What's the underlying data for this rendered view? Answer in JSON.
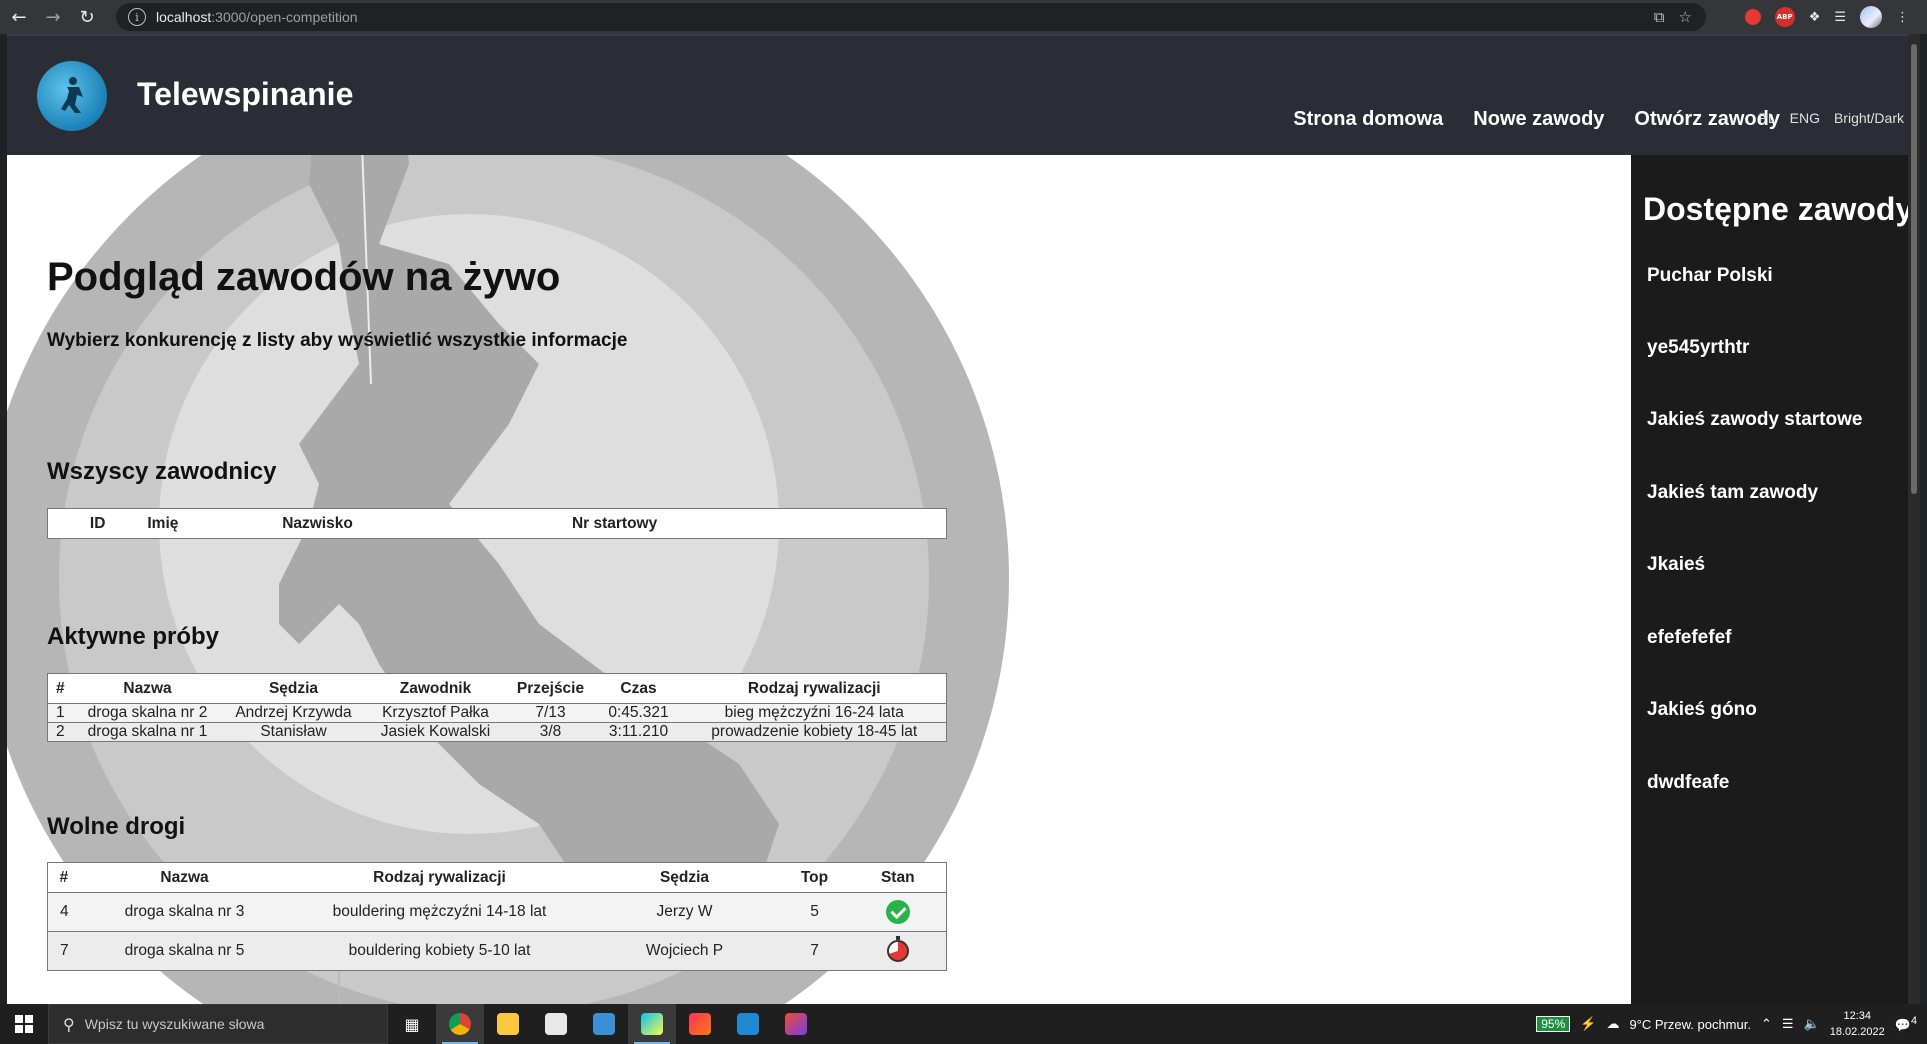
{
  "browser": {
    "url_host": "localhost",
    "url_path": ":3000/open-competition"
  },
  "app": {
    "brand": "Telewspinanie",
    "nav": [
      "Strona domowa",
      "Nowe zawody",
      "Otwórz zawody"
    ],
    "langs": [
      "PL",
      "ENG",
      "Bright/Dark"
    ]
  },
  "main": {
    "title": "Podgląd zawodów na żywo",
    "subtitle": "Wybierz konkurencję z listy aby wyświetlić wszystkie informacje",
    "competitors": {
      "heading": "Wszyscy zawodnicy",
      "headers": [
        "ID",
        "Imię",
        "Nazwisko",
        "Nr startowy"
      ]
    },
    "active": {
      "heading": "Aktywne próby",
      "headers": [
        "#",
        "Nazwa",
        "Sędzia",
        "Zawodnik",
        "Przejście",
        "Czas",
        "Rodzaj rywalizacji"
      ],
      "rows": [
        [
          "1",
          "droga skalna nr 2",
          "Andrzej Krzywda",
          "Krzysztof Pałka",
          "7/13",
          "0:45.321",
          "bieg mężczyźni 16-24 lata"
        ],
        [
          "2",
          "droga skalna nr 1",
          "Stanisław",
          "Jasiek Kowalski",
          "3/8",
          "3:11.210",
          "prowadzenie kobiety 18-45 lat"
        ]
      ]
    },
    "free": {
      "heading": "Wolne drogi",
      "headers": [
        "#",
        "Nazwa",
        "Rodzaj rywalizacji",
        "Sędzia",
        "Top",
        "Stan"
      ],
      "rows": [
        {
          "n": "4",
          "name": "droga skalna nr 3",
          "type": "bouldering mężczyźni 14-18 lat",
          "judge": "Jerzy W",
          "top": "5",
          "state": "check-icon"
        },
        {
          "n": "7",
          "name": "droga skalna nr 5",
          "type": "bouldering kobiety 5-10 lat",
          "judge": "Wojciech P",
          "top": "7",
          "state": "timer-icon"
        }
      ]
    }
  },
  "sidebar": {
    "title": "Dostępne zawody",
    "items": [
      "Puchar Polski",
      "ye545yrthtr",
      "Jakieś zawody startowe",
      "Jakieś tam zawody",
      "Jkaieś",
      "efefefefef",
      "Jakieś góno",
      "dwdfeafe"
    ]
  },
  "taskbar": {
    "search_placeholder": "Wpisz tu wyszukiwane słowa",
    "battery": "95%",
    "weather": "9°C  Przew. pochmur.",
    "time": "12:34",
    "date": "18.02.2022",
    "notifications": "4"
  }
}
